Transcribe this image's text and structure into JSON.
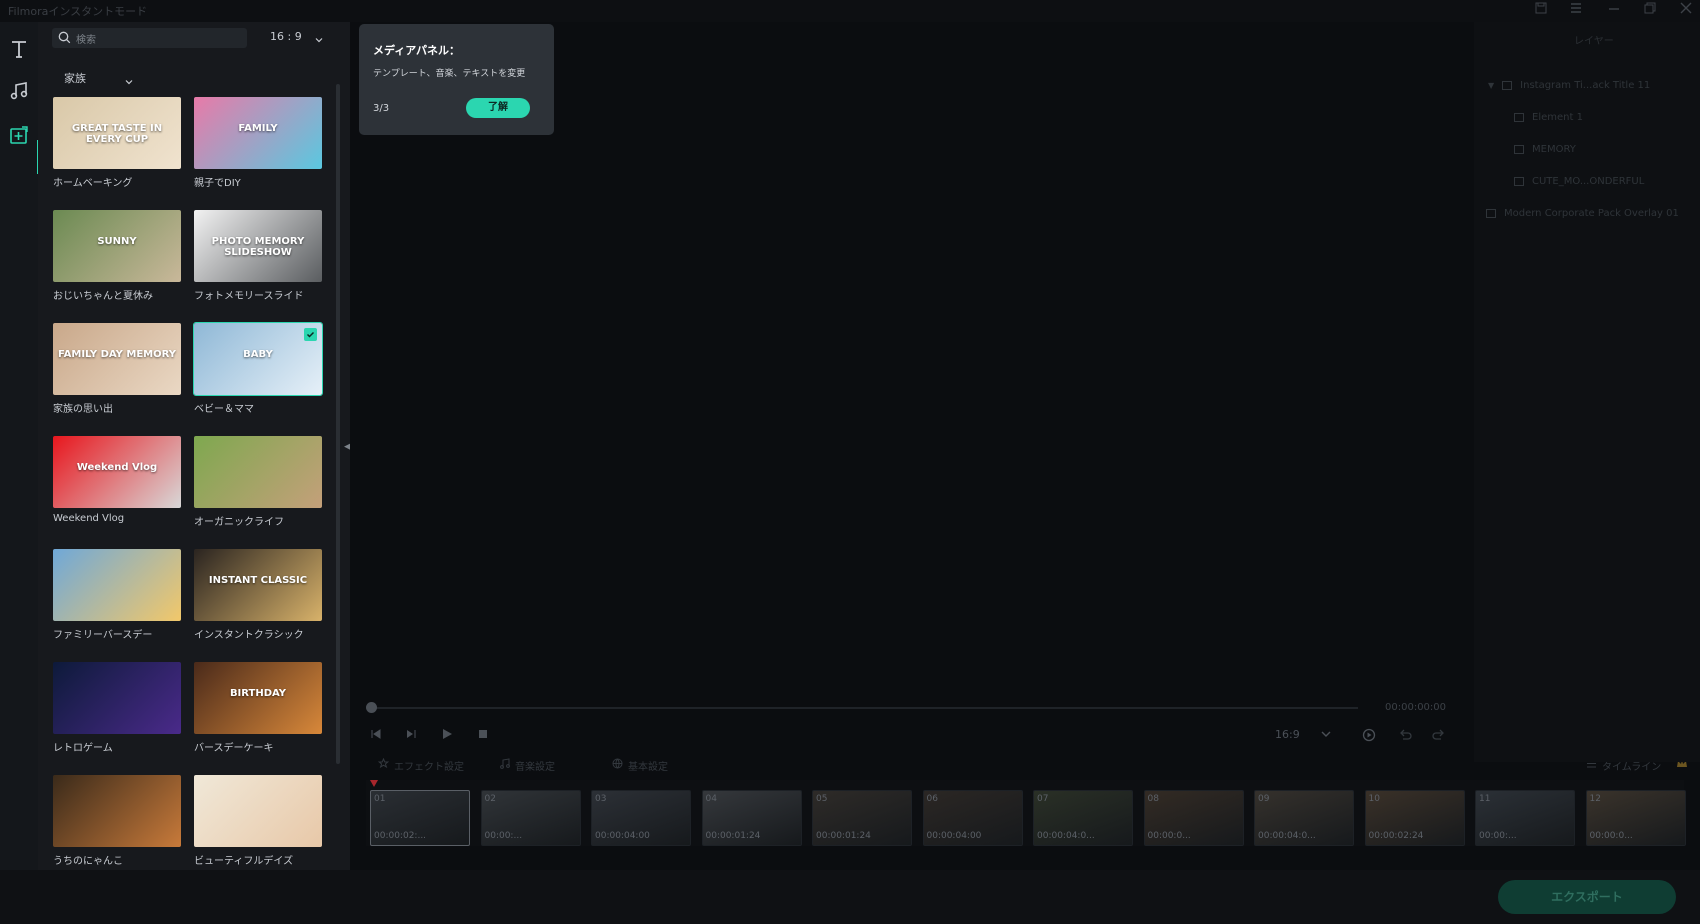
{
  "window": {
    "title": "Filmoraインスタントモード",
    "controls": [
      "save-icon",
      "list-icon",
      "minimize-icon",
      "restore-icon",
      "close-icon"
    ]
  },
  "toolbar": {
    "tools": [
      "text-icon",
      "music-icon",
      "media-icon"
    ],
    "accent": "#2bd6b0"
  },
  "media_panel": {
    "search_placeholder": "検索",
    "aspect_ratio": "16 : 9",
    "category": "家族",
    "templates": [
      {
        "label": "ホームベーキング",
        "thumb_text": "GREAT TASTE IN EVERY CUP",
        "colors": [
          "#d9c8a8",
          "#f0e3cf"
        ]
      },
      {
        "label": "親子でDIY",
        "thumb_text": "FAMILY",
        "colors": [
          "#e87aa8",
          "#5ac8e0"
        ]
      },
      {
        "label": "おじいちゃんと夏休み",
        "thumb_text": "SUNNY",
        "colors": [
          "#6b8a52",
          "#c9b89a"
        ]
      },
      {
        "label": "フォトメモリースライド",
        "thumb_text": "PHOTO MEMORY SLIDESHOW",
        "colors": [
          "#f2f2f2",
          "#5a5d60"
        ]
      },
      {
        "label": "家族の思い出",
        "thumb_text": "FAMILY DAY MEMORY",
        "colors": [
          "#c9a88a",
          "#ead8c4"
        ]
      },
      {
        "label": "ベビー＆ママ",
        "thumb_text": "BABY",
        "colors": [
          "#8fb8d6",
          "#e6f0f8"
        ],
        "selected": true
      },
      {
        "label": "Weekend Vlog",
        "thumb_text": "Weekend Vlog",
        "colors": [
          "#e8161d",
          "#d8d8d8"
        ]
      },
      {
        "label": "オーガニックライフ",
        "thumb_text": "",
        "colors": [
          "#7ea84f",
          "#c4a07a"
        ]
      },
      {
        "label": "ファミリーバースデー",
        "thumb_text": "",
        "colors": [
          "#6fa8d8",
          "#f2c86a"
        ]
      },
      {
        "label": "インスタントクラシック",
        "thumb_text": "INSTANT CLASSIC",
        "colors": [
          "#2a2420",
          "#d8b26a"
        ]
      },
      {
        "label": "レトロゲーム",
        "thumb_text": "",
        "colors": [
          "#0d1a3a",
          "#4a2a8a"
        ]
      },
      {
        "label": "バースデーケーキ",
        "thumb_text": "BIRTHDAY",
        "colors": [
          "#4a2a1a",
          "#d8883a"
        ]
      },
      {
        "label": "うちのにゃんこ",
        "thumb_text": "",
        "colors": [
          "#3a2a1a",
          "#c87a3a"
        ]
      },
      {
        "label": "ビューティフルデイズ",
        "thumb_text": "",
        "colors": [
          "#f0e8d8",
          "#e8c8a8"
        ]
      }
    ]
  },
  "tooltip": {
    "title": "メディアパネル：",
    "body": "テンプレート、音楽、テキストを変更",
    "step": "3/3",
    "button": "了解"
  },
  "player": {
    "timecode": "00:00:00:00",
    "aspect": "16:9",
    "tabs": [
      "エフェクト設定",
      "音楽設定",
      "基本設定"
    ],
    "timeline_label": "タイムライン"
  },
  "clips": [
    {
      "num": "01",
      "duration": "00:00:02:..."
    },
    {
      "num": "02",
      "duration": "00:00:..."
    },
    {
      "num": "03",
      "duration": "00:00:04:00"
    },
    {
      "num": "04",
      "duration": "00:00:01:24"
    },
    {
      "num": "05",
      "duration": "00:00:01:24"
    },
    {
      "num": "06",
      "duration": "00:00:04:00"
    },
    {
      "num": "07",
      "duration": "00:00:04:0..."
    },
    {
      "num": "08",
      "duration": "00:00:0..."
    },
    {
      "num": "09",
      "duration": "00:00:04:0..."
    },
    {
      "num": "10",
      "duration": "00:00:02:24"
    },
    {
      "num": "11",
      "duration": "00:00:..."
    },
    {
      "num": "12",
      "duration": "00:00:0..."
    }
  ],
  "layers": {
    "title": "レイヤー",
    "items": [
      {
        "label": "Instagram Ti...ack Title 11",
        "level": 0,
        "expanded": true
      },
      {
        "label": "Element 1",
        "level": 1
      },
      {
        "label": "MEMORY",
        "level": 1
      },
      {
        "label": "CUTE_MO...ONDERFUL",
        "level": 1
      },
      {
        "label": "Modern Corporate Pack Overlay 01",
        "level": 0
      }
    ]
  },
  "export_button": "エクスポート"
}
